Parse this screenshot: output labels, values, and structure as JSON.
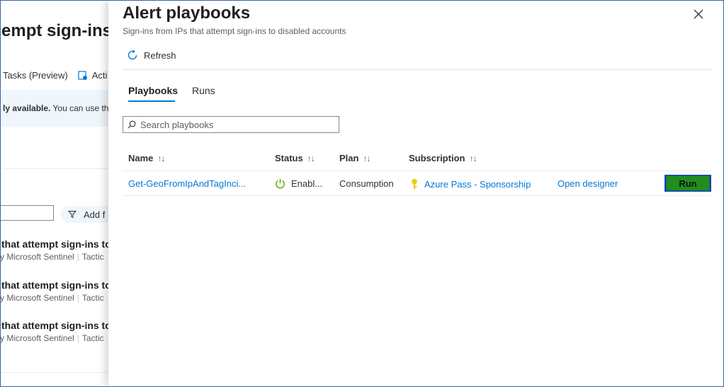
{
  "background_page": {
    "title": "empt sign-ins",
    "toolbar": {
      "tasks_label": "Tasks (Preview)",
      "action_label": "Acti"
    },
    "info_banner": {
      "bold_text": "ly available.",
      "text": " You can use th"
    },
    "filter_label": "Add f",
    "rules": [
      {
        "title": "that attempt sign-ins to",
        "source": "y Microsoft Sentinel",
        "tactics": "Tactic"
      },
      {
        "title": "that attempt sign-ins to",
        "source": "y Microsoft Sentinel",
        "tactics": "Tactic"
      },
      {
        "title": "that attempt sign-ins to",
        "source": "y Microsoft Sentinel",
        "tactics": "Tactic"
      }
    ]
  },
  "panel": {
    "title": "Alert playbooks",
    "subtitle": "Sign-ins from IPs that attempt sign-ins to disabled accounts",
    "refresh_label": "Refresh",
    "tabs": [
      {
        "label": "Playbooks",
        "active": true
      },
      {
        "label": "Runs",
        "active": false
      }
    ],
    "search": {
      "placeholder": "Search playbooks",
      "value": ""
    },
    "table": {
      "columns": [
        "Name",
        "Status",
        "Plan",
        "Subscription"
      ],
      "rows": [
        {
          "name": "Get-GeoFromIpAndTagInci...",
          "status": "Enabl...",
          "plan": "Consumption",
          "subscription": "Azure Pass - Sponsorship",
          "designer_label": "Open designer",
          "run_label": "Run"
        }
      ]
    }
  },
  "colors": {
    "accent": "#0078d4",
    "status_enabled": "#57a300",
    "key_icon": "#f2c811",
    "run_button_fill": "#1f8f1c",
    "run_button_border": "#1b4da0"
  },
  "icons": {
    "close": "close-icon",
    "refresh": "refresh-icon",
    "search": "search-icon",
    "sort": "sort-icon",
    "status": "power-icon",
    "subscription": "key-icon",
    "filter": "filter-icon",
    "action": "action-icon"
  }
}
